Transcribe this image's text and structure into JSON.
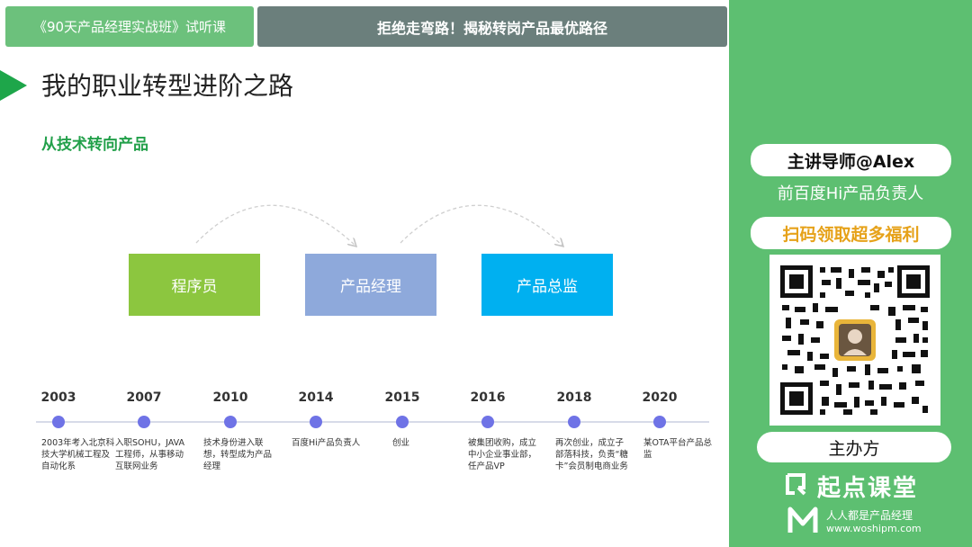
{
  "header": {
    "course_tab": "《90天产品经理实战班》试听课",
    "topic_tab": "拒绝走弯路！揭秘转岗产品最优路径"
  },
  "slide": {
    "title": "我的职业转型进阶之路",
    "subtitle": "从技术转向产品"
  },
  "flow": [
    "程序员",
    "产品经理",
    "产品总监"
  ],
  "timeline": [
    {
      "year": "2003",
      "desc": "2003年考入北京科技大学机械工程及自动化系"
    },
    {
      "year": "2007",
      "desc": "入职SOHU，JAVA工程师，从事移动互联网业务"
    },
    {
      "year": "2010",
      "desc": "技术身份进入联想，转型成为产品经理"
    },
    {
      "year": "2014",
      "desc": "百度Hi产品负责人"
    },
    {
      "year": "2015",
      "desc": "创业"
    },
    {
      "year": "2016",
      "desc": "被集团收购，成立中小企业事业部，任产品VP"
    },
    {
      "year": "2018",
      "desc": "再次创业，成立子部落科技，负责“糖卡”会员制电商业务"
    },
    {
      "year": "2020",
      "desc": "某OTA平台产品总监"
    }
  ],
  "sidebar": {
    "speaker": "主讲导师@Alex",
    "speaker_role": "前百度Hi产品负责人",
    "promo": "扫码领取超多福利",
    "host_label": "主办方",
    "brand_name": "起点课堂",
    "brand2_name": "人人都是产品经理",
    "brand2_url": "www.woshipm.com"
  },
  "colors": {
    "accent_green": "#1ea64a",
    "panel_green": "#5dbf71",
    "box_programmer": "#8cc63f",
    "box_pm": "#8ea9db",
    "box_director": "#00b0f0",
    "timeline_dot": "#6f73e6",
    "promo_text": "#e6a21a"
  }
}
